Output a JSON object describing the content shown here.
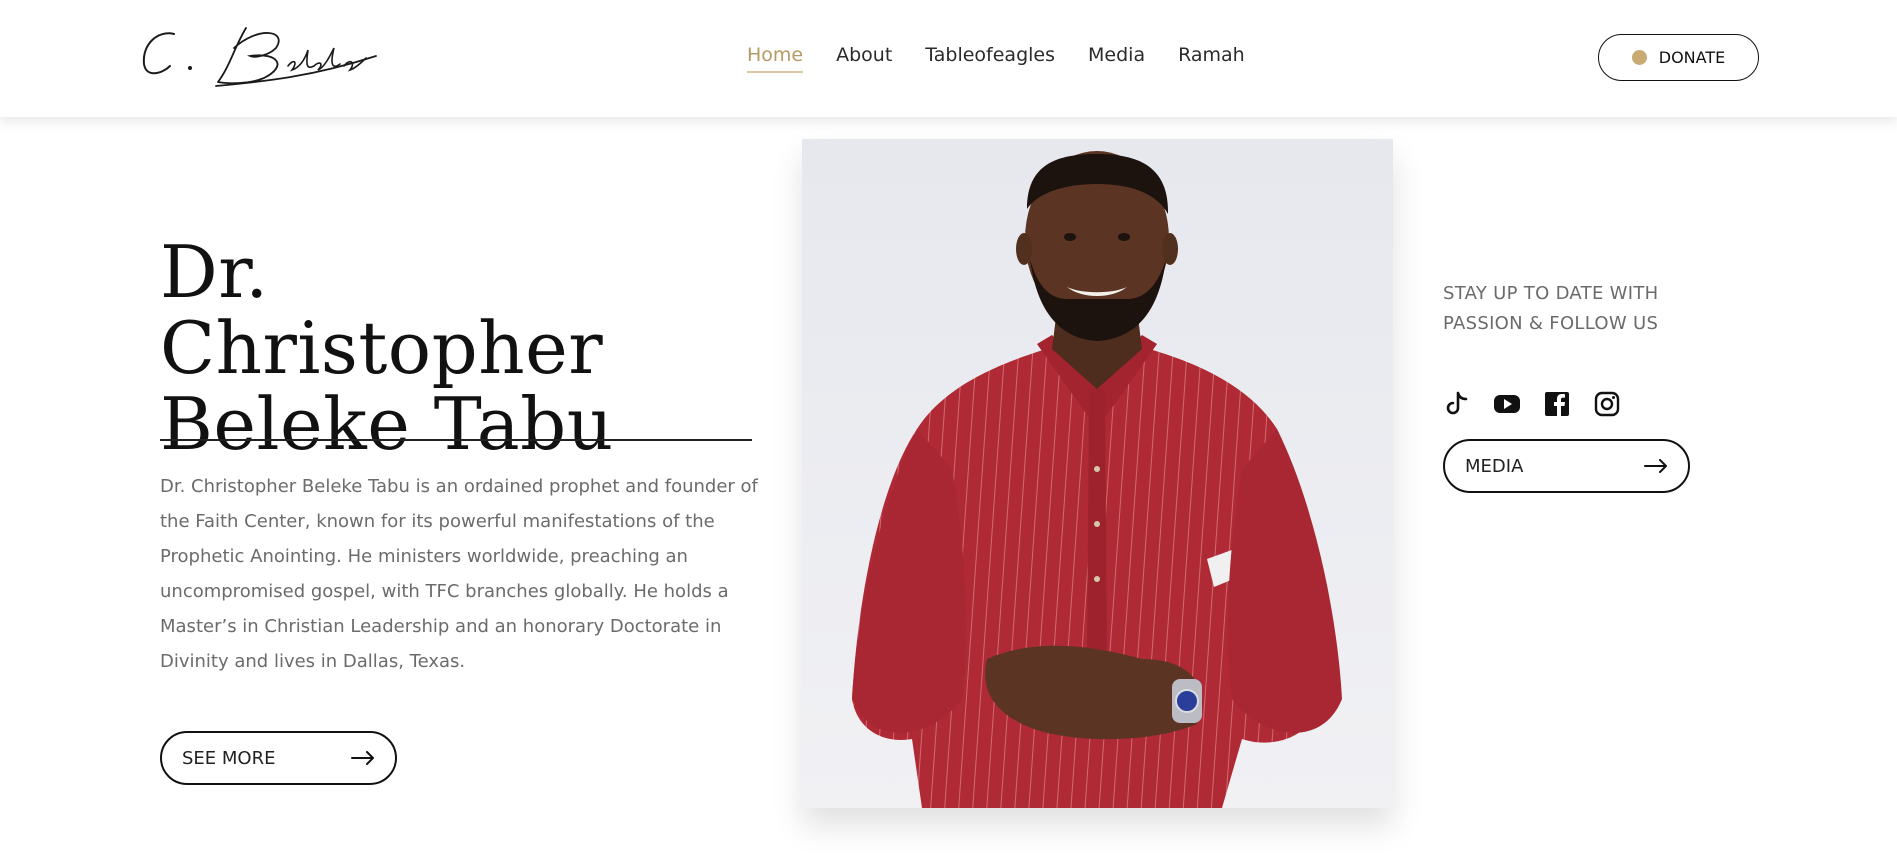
{
  "header": {
    "logo_text": "C. Beleke",
    "nav": [
      {
        "label": "Home",
        "active": true
      },
      {
        "label": "About",
        "active": false
      },
      {
        "label": "Tableofeagles",
        "active": false
      },
      {
        "label": "Media",
        "active": false
      },
      {
        "label": "Ramah",
        "active": false
      }
    ],
    "donate_label": "DONATE"
  },
  "hero": {
    "title": "Dr. Christopher Beleke Tabu",
    "bio": "Dr. Christopher Beleke Tabu is an ordained prophet and founder of the Faith Center, known for its powerful manifestations of the Prophetic Anointing. He ministers worldwide, preaching an uncompromised gospel, with TFC branches globally. He holds a Master’s in Christian Leadership and an honorary Doctorate in Divinity and lives in Dallas, Texas.",
    "see_more_label": "SEE MORE"
  },
  "follow": {
    "text": "STAY UP TO DATE WITH PASSION & FOLLOW US",
    "social": [
      {
        "name": "tiktok-icon"
      },
      {
        "name": "youtube-icon"
      },
      {
        "name": "facebook-icon"
      },
      {
        "name": "instagram-icon"
      }
    ],
    "media_label": "MEDIA"
  },
  "colors": {
    "accent": "#b59a63",
    "donate_dot": "#c7ab73",
    "text_dark": "#111111",
    "text_muted": "#6b6b6b",
    "shirt_red": "#b02a36"
  }
}
